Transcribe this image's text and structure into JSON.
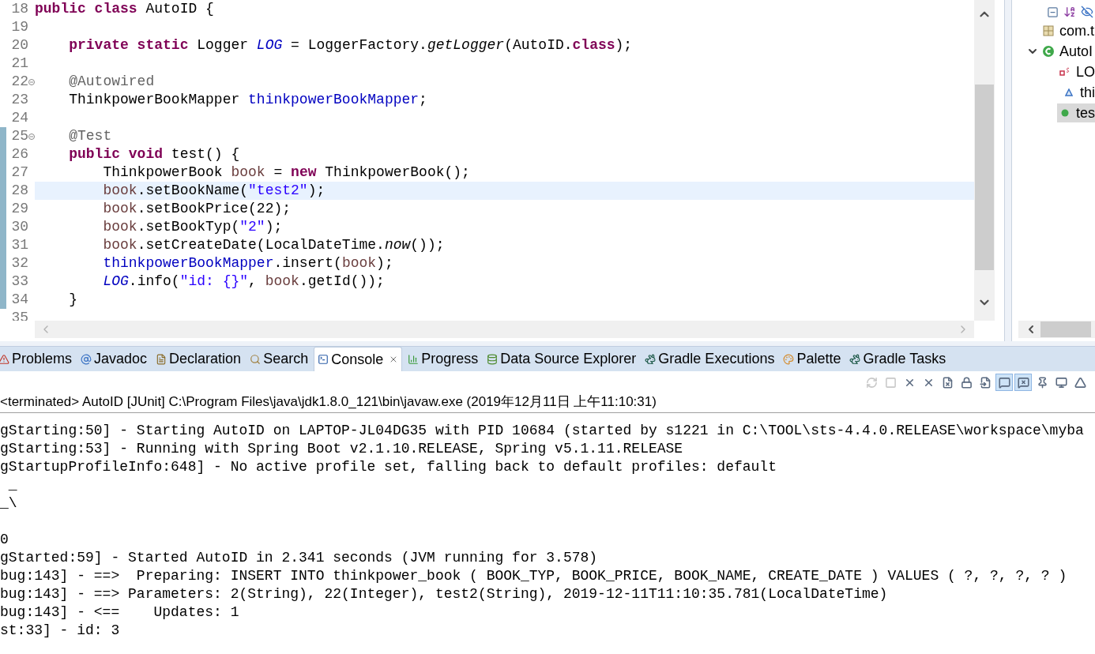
{
  "editor": {
    "lines": [
      {
        "number": "18",
        "foldable": false,
        "changed": false,
        "current": false,
        "tokens": [
          {
            "text": "public class ",
            "kind": "keyword"
          },
          {
            "text": "AutoID {",
            "kind": "plain"
          }
        ]
      },
      {
        "number": "19",
        "foldable": false,
        "changed": false,
        "current": false
      },
      {
        "number": "20",
        "foldable": false,
        "changed": false,
        "current": false,
        "tokens": [
          {
            "text": "    private static ",
            "kind": "keyword"
          },
          {
            "text": "Logger ",
            "kind": "plain"
          },
          {
            "text": "LOG",
            "kind": "static-field"
          },
          {
            "text": " = LoggerFactory.",
            "kind": "plain"
          },
          {
            "text": "getLogger",
            "kind": "static-method"
          },
          {
            "text": "(AutoID.",
            "kind": "plain"
          },
          {
            "text": "class",
            "kind": "keyword"
          },
          {
            "text": ");",
            "kind": "plain"
          }
        ]
      },
      {
        "number": "21",
        "foldable": false,
        "changed": false,
        "current": false
      },
      {
        "number": "22",
        "foldable": true,
        "changed": false,
        "current": false,
        "tokens": [
          {
            "text": "    @Autowired",
            "kind": "annotation"
          }
        ]
      },
      {
        "number": "23",
        "foldable": false,
        "changed": false,
        "current": false,
        "tokens": [
          {
            "text": "    ThinkpowerBookMapper ",
            "kind": "plain"
          },
          {
            "text": "thinkpowerBookMapper",
            "kind": "field"
          },
          {
            "text": ";",
            "kind": "plain"
          }
        ]
      },
      {
        "number": "24",
        "foldable": false,
        "changed": false,
        "current": false
      },
      {
        "number": "25",
        "foldable": true,
        "changed": true,
        "current": false,
        "tokens": [
          {
            "text": "    @Test",
            "kind": "annotation"
          }
        ]
      },
      {
        "number": "26",
        "foldable": false,
        "changed": true,
        "current": false,
        "tokens": [
          {
            "text": "    public void ",
            "kind": "keyword"
          },
          {
            "text": "test() {",
            "kind": "plain"
          }
        ]
      },
      {
        "number": "27",
        "foldable": false,
        "changed": true,
        "current": false,
        "tokens": [
          {
            "text": "        ThinkpowerBook ",
            "kind": "plain"
          },
          {
            "text": "book",
            "kind": "local"
          },
          {
            "text": " = ",
            "kind": "plain"
          },
          {
            "text": "new",
            "kind": "keyword"
          },
          {
            "text": " ThinkpowerBook();",
            "kind": "plain"
          }
        ]
      },
      {
        "number": "28",
        "foldable": false,
        "changed": true,
        "current": true,
        "tokens": [
          {
            "text": "        book",
            "kind": "local"
          },
          {
            "text": ".setBookName(",
            "kind": "plain"
          },
          {
            "text": "\"test2\"",
            "kind": "string"
          },
          {
            "text": ");",
            "kind": "plain"
          }
        ]
      },
      {
        "number": "29",
        "foldable": false,
        "changed": true,
        "current": false,
        "tokens": [
          {
            "text": "        book",
            "kind": "local"
          },
          {
            "text": ".setBookPrice(22);",
            "kind": "plain"
          }
        ]
      },
      {
        "number": "30",
        "foldable": false,
        "changed": true,
        "current": false,
        "tokens": [
          {
            "text": "        book",
            "kind": "local"
          },
          {
            "text": ".setBookTyp(",
            "kind": "plain"
          },
          {
            "text": "\"2\"",
            "kind": "string"
          },
          {
            "text": ");",
            "kind": "plain"
          }
        ]
      },
      {
        "number": "31",
        "foldable": false,
        "changed": true,
        "current": false,
        "tokens": [
          {
            "text": "        book",
            "kind": "local"
          },
          {
            "text": ".setCreateDate(LocalDateTime.",
            "kind": "plain"
          },
          {
            "text": "now",
            "kind": "static-method"
          },
          {
            "text": "());",
            "kind": "plain"
          }
        ]
      },
      {
        "number": "32",
        "foldable": false,
        "changed": true,
        "current": false,
        "tokens": [
          {
            "text": "        thinkpowerBookMapper",
            "kind": "field"
          },
          {
            "text": ".insert(",
            "kind": "plain"
          },
          {
            "text": "book",
            "kind": "local"
          },
          {
            "text": ");",
            "kind": "plain"
          }
        ]
      },
      {
        "number": "33",
        "foldable": false,
        "changed": true,
        "current": false,
        "tokens": [
          {
            "text": "        LOG",
            "kind": "static-field"
          },
          {
            "text": ".info(",
            "kind": "plain"
          },
          {
            "text": "\"id: {}\"",
            "kind": "string"
          },
          {
            "text": ", ",
            "kind": "plain"
          },
          {
            "text": "book",
            "kind": "local"
          },
          {
            "text": ".getId());",
            "kind": "plain"
          }
        ]
      },
      {
        "number": "34",
        "foldable": false,
        "changed": true,
        "current": false,
        "tokens": [
          {
            "text": "    }",
            "kind": "plain"
          }
        ]
      },
      {
        "number": "35",
        "foldable": false,
        "changed": false,
        "current": false
      }
    ]
  },
  "outline": {
    "items": [
      {
        "label": "com.t",
        "kind": "package",
        "selected": false
      },
      {
        "label": "AutoI",
        "kind": "class",
        "selected": false,
        "expanded": true,
        "children": [
          {
            "label": "LO",
            "kind": "static-field",
            "selected": false
          },
          {
            "label": "thi",
            "kind": "field",
            "selected": false
          },
          {
            "label": "tes",
            "kind": "method",
            "selected": true
          }
        ]
      }
    ]
  },
  "tabs": [
    {
      "label": "Problems",
      "selected": false
    },
    {
      "label": "Javadoc",
      "selected": false
    },
    {
      "label": "Declaration",
      "selected": false
    },
    {
      "label": "Search",
      "selected": false
    },
    {
      "label": "Console",
      "selected": true
    },
    {
      "label": "Progress",
      "selected": false
    },
    {
      "label": "Data Source Explorer",
      "selected": false
    },
    {
      "label": "Gradle Executions",
      "selected": false
    },
    {
      "label": "Palette",
      "selected": false
    },
    {
      "label": "Gradle Tasks",
      "selected": false
    }
  ],
  "console": {
    "toolbar": [
      {
        "disabled": true,
        "pressed": false
      },
      {
        "disabled": true,
        "pressed": false
      },
      {
        "disabled": false,
        "pressed": false
      },
      {
        "disabled": false,
        "pressed": false
      },
      {
        "disabled": false,
        "pressed": false
      },
      {
        "disabled": false,
        "pressed": false
      },
      {
        "disabled": false,
        "pressed": false
      },
      {
        "disabled": false,
        "pressed": true
      },
      {
        "disabled": false,
        "pressed": true
      },
      {
        "disabled": false,
        "pressed": false
      },
      {
        "disabled": false,
        "pressed": false
      },
      {
        "disabled": false,
        "pressed": false
      }
    ],
    "header": "<terminated> AutoID [JUnit] C:\\Program Files\\java\\jdk1.8.0_121\\bin\\javaw.exe (2019年12月11日 上午11:10:31)",
    "lines": [
      {
        "text": "gStarting:50] - Starting AutoID on LAPTOP-JL04DG35 with PID 10684 (started by s1221 in C:\\TOOL\\sts-4.4.0.RELEASE\\workspace\\myba",
        "space_before": false
      },
      {
        "text": "gStarting:53] - Running with Spring Boot v2.1.10.RELEASE, Spring v5.1.11.RELEASE",
        "space_before": false
      },
      {
        "text": "gStartupProfileInfo:648] - No active profile set, falling back to default profiles: default",
        "space_before": false
      },
      {
        "text": " _",
        "space_before": false
      },
      {
        "text": "_\\",
        "space_before": false
      },
      {
        "text": "0",
        "space_before": true
      },
      {
        "text": "gStarted:59] - Started AutoID in 2.341 seconds (JVM running for 3.578)",
        "space_before": false
      },
      {
        "text": "bug:143] - ==>  Preparing: INSERT INTO thinkpower_book ( BOOK_TYP, BOOK_PRICE, BOOK_NAME, CREATE_DATE ) VALUES ( ?, ?, ?, ? )",
        "space_before": false
      },
      {
        "text": "bug:143] - ==> Parameters: 2(String), 22(Integer), test2(String), 2019-12-11T11:10:35.781(LocalDateTime)",
        "space_before": false
      },
      {
        "text": "bug:143] - <==    Updates: 1",
        "space_before": false
      },
      {
        "text": "st:33] - id: 3",
        "space_before": false
      }
    ]
  }
}
